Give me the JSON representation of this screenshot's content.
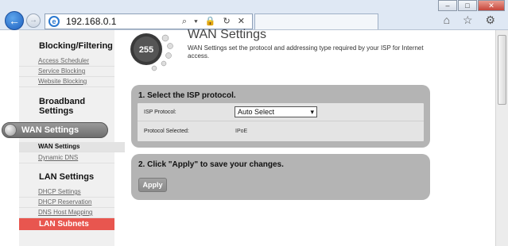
{
  "browser": {
    "url": "192.168.0.1",
    "window_buttons": [
      "–",
      "□",
      "✕"
    ],
    "address_icons": "⌕ ▾ 🔒 ↻ ✕",
    "toolbar_icons": "⌂ ☆ ⚙"
  },
  "sidebar": {
    "blocking_title": "Blocking/Filtering",
    "blocking_items": [
      "Access Scheduler",
      "Service Blocking",
      "Website Blocking"
    ],
    "broadband_title": "Broadband Settings",
    "wan_title": "WAN Settings",
    "wan_items": [
      "WAN Settings",
      "Dynamic DNS"
    ],
    "lan_title": "LAN Settings",
    "lan_items": [
      "DHCP Settings",
      "DHCP Reservation",
      "DNS Host Mapping"
    ],
    "lan_subnets": "LAN Subnets"
  },
  "main": {
    "logo_text": "255",
    "title": "WAN Settings",
    "description": "WAN Settings set the protocol and addressing type required by your ISP for Internet access.",
    "section1_title": "1. Select the ISP protocol.",
    "isp_protocol_label": "ISP Protocol:",
    "isp_protocol_value": "Auto Select",
    "protocol_selected_label": "Protocol Selected:",
    "protocol_selected_value": "IPoE",
    "section2_title": "2. Click \"Apply\" to save your changes.",
    "apply_label": "Apply"
  },
  "colors": {
    "panel": "#b4b4b4",
    "highlight": "#e8564f",
    "active_pill": "#808080"
  }
}
